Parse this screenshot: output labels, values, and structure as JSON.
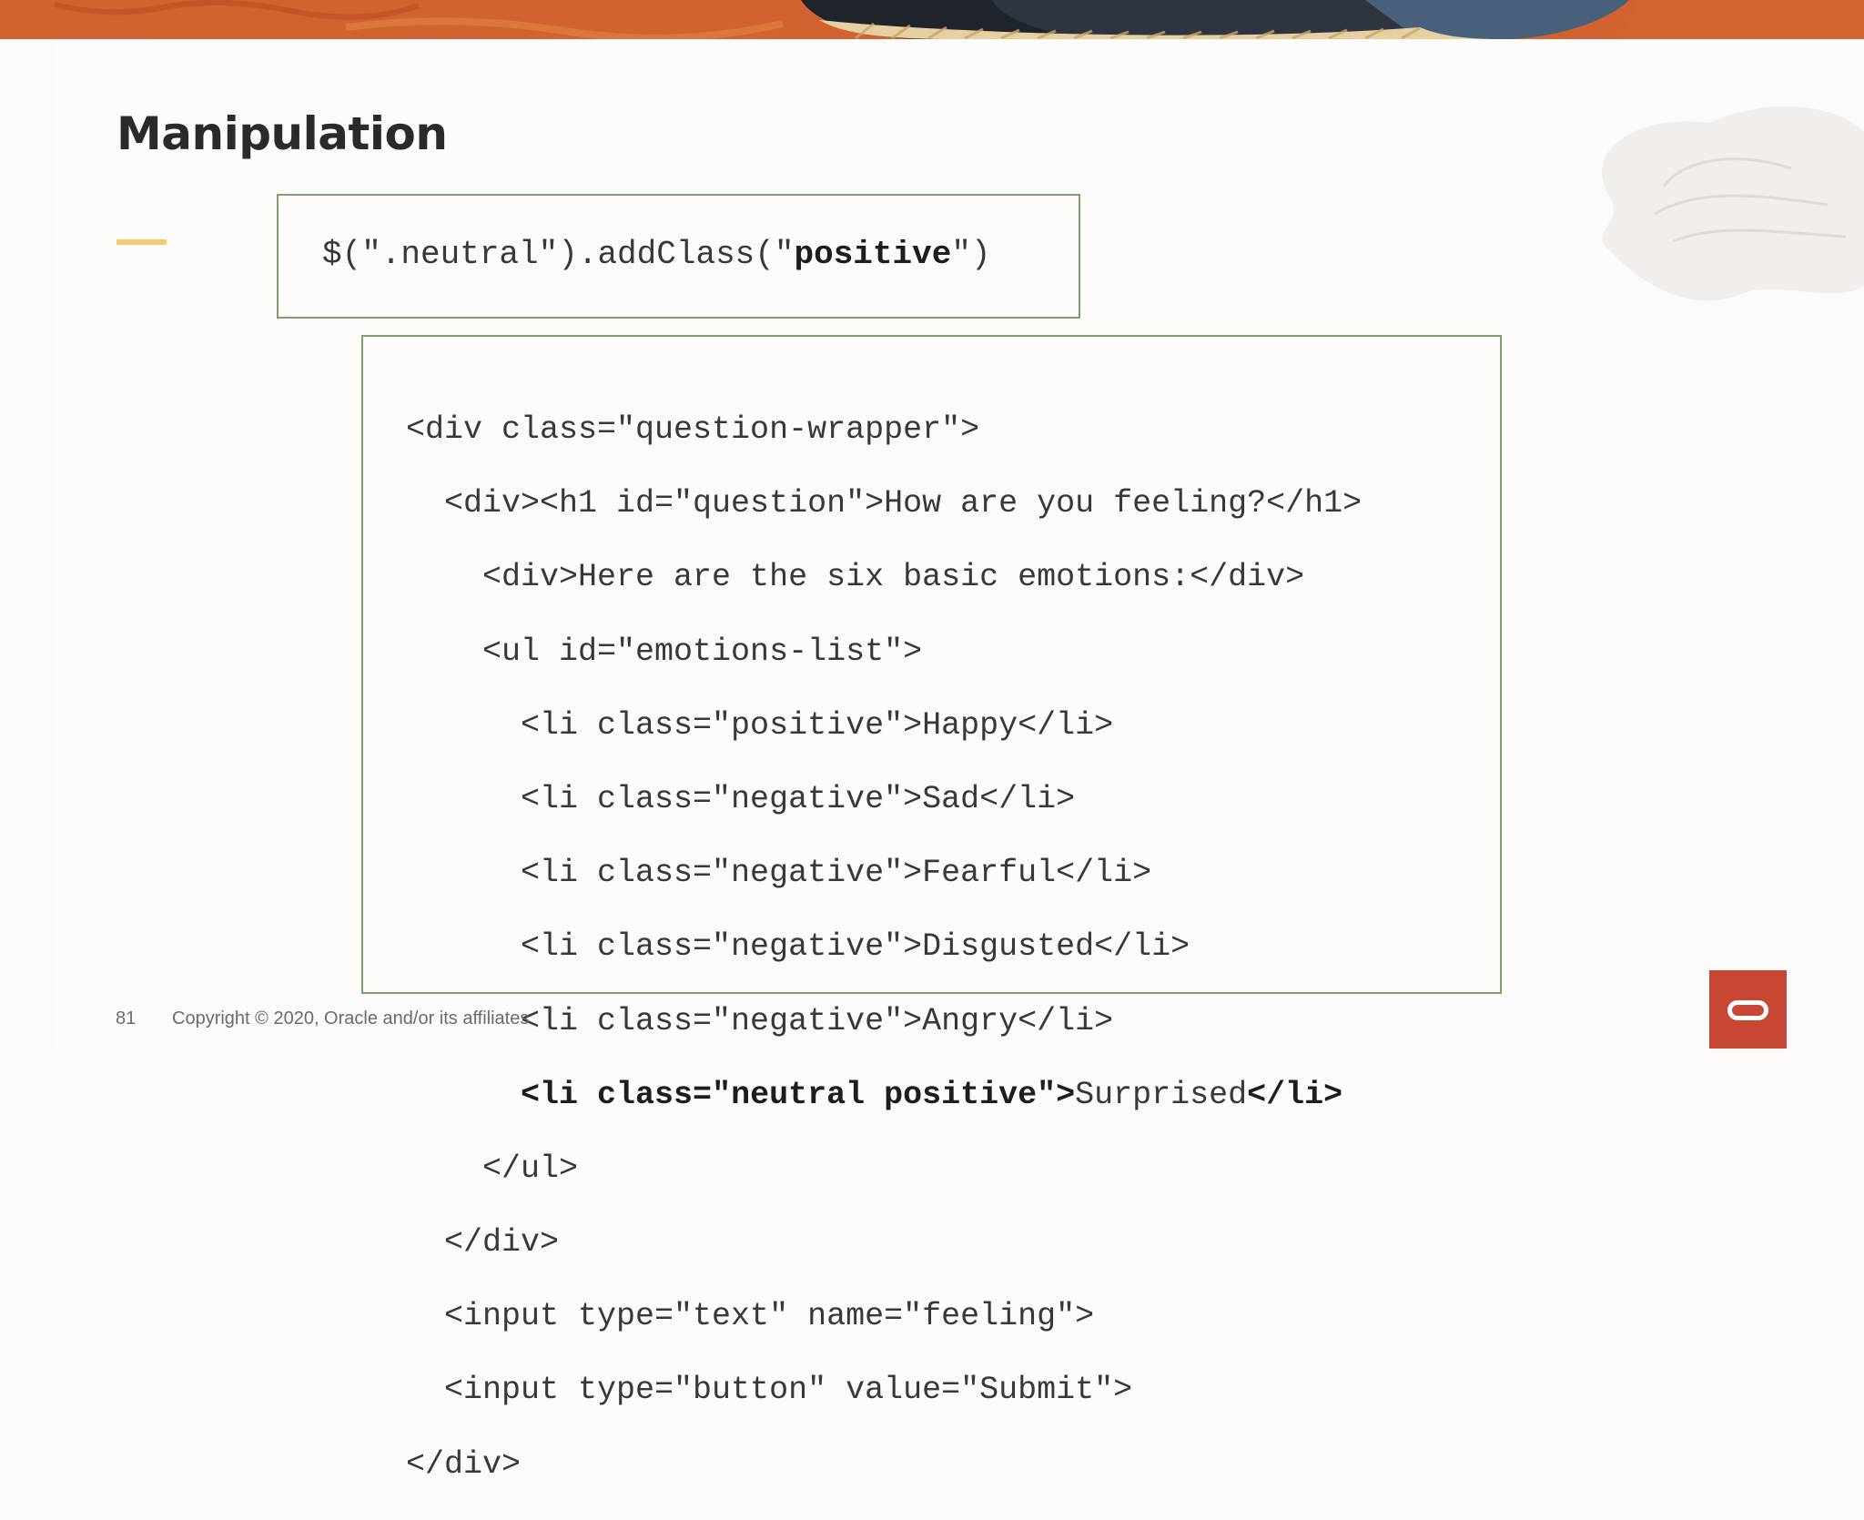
{
  "slide": {
    "title": "Manipulation",
    "page_number": "81",
    "copyright": "Copyright © 2020, Oracle and/or its affiliates"
  },
  "jquery_code": {
    "prefix": "$(\".neutral\").addClass(\"",
    "emphasis": "positive",
    "suffix": "\")"
  },
  "html_code": {
    "lines": [
      "<div class=\"question-wrapper\">",
      "  <div><h1 id=\"question\">How are you feeling?</h1>",
      "    <div>Here are the six basic emotions:</div>",
      "    <ul id=\"emotions-list\">",
      "      <li class=\"positive\">Happy</li>",
      "      <li class=\"negative\">Sad</li>",
      "      <li class=\"negative\">Fearful</li>",
      "      <li class=\"negative\">Disgusted</li>",
      "      <li class=\"negative\">Angry</li>",
      "    </ul>",
      "  </div>",
      "  <input type=\"text\" name=\"feeling\">",
      "  <input type=\"button\" value=\"Submit\">",
      "</div>"
    ],
    "highlight": {
      "indent": "      ",
      "open_tag": "<li class=\"neutral positive\">",
      "text": "Surprised",
      "close_tag": "</li>"
    }
  },
  "colors": {
    "box_border": "#7fa06e",
    "accent": "#f0cc71",
    "brand": "#c74634",
    "banner": "#d86a34"
  },
  "icons": [
    "oracle-logo-icon"
  ]
}
